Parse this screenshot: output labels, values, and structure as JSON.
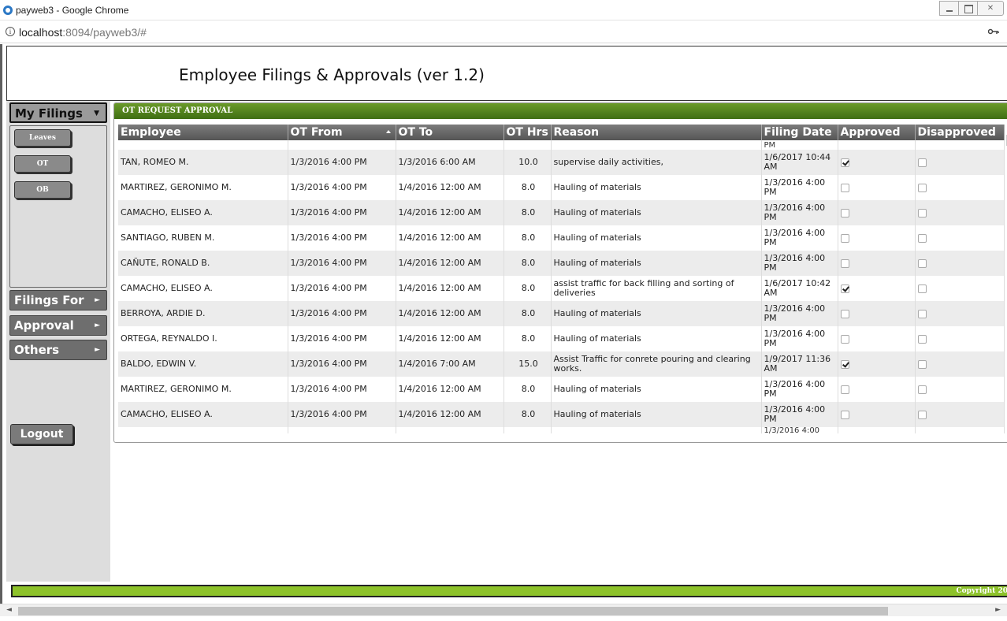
{
  "window": {
    "title": "payweb3 - Google Chrome",
    "url_host": "localhost",
    "url_rest": ":8094/payweb3/#"
  },
  "header": {
    "title": "Employee Filings & Approvals (ver 1.2)"
  },
  "sidebar": {
    "my_filings": "My Filings",
    "sub_buttons": [
      "Leaves",
      "OT",
      "OB"
    ],
    "filings_for": "Filings For",
    "approval": "Approval",
    "others": "Others",
    "logout": "Logout"
  },
  "panel": {
    "title": "OT REQUEST APPROVAL",
    "columns": [
      "Employee",
      "OT From",
      "OT To",
      "OT Hrs",
      "Reason",
      "Filing Date",
      "Approved",
      "Disapproved"
    ],
    "top_partial": {
      "filing_date": "PM"
    },
    "rows": [
      {
        "employee": "TAN, ROMEO M.",
        "ot_from": "1/3/2016 4:00 PM",
        "ot_to": "1/3/2016 6:00 AM",
        "ot_hrs": "10.0",
        "reason": "supervise daily activities,",
        "filing_date": "1/6/2017 10:44 AM",
        "approved": true,
        "disapproved": false
      },
      {
        "employee": "MARTIREZ, GERONIMO M.",
        "ot_from": "1/3/2016 4:00 PM",
        "ot_to": "1/4/2016 12:00 AM",
        "ot_hrs": "8.0",
        "reason": "Hauling of materials",
        "filing_date": "1/3/2016 4:00 PM",
        "approved": false,
        "disapproved": false
      },
      {
        "employee": "CAMACHO, ELISEO A.",
        "ot_from": "1/3/2016 4:00 PM",
        "ot_to": "1/4/2016 12:00 AM",
        "ot_hrs": "8.0",
        "reason": "Hauling of materials",
        "filing_date": "1/3/2016 4:00 PM",
        "approved": false,
        "disapproved": false
      },
      {
        "employee": "SANTIAGO, RUBEN M.",
        "ot_from": "1/3/2016 4:00 PM",
        "ot_to": "1/4/2016 12:00 AM",
        "ot_hrs": "8.0",
        "reason": "Hauling of materials",
        "filing_date": "1/3/2016 4:00 PM",
        "approved": false,
        "disapproved": false
      },
      {
        "employee": "CAÑUTE, RONALD B.",
        "ot_from": "1/3/2016 4:00 PM",
        "ot_to": "1/4/2016 12:00 AM",
        "ot_hrs": "8.0",
        "reason": "Hauling of materials",
        "filing_date": "1/3/2016 4:00 PM",
        "approved": false,
        "disapproved": false
      },
      {
        "employee": "CAMACHO, ELISEO A.",
        "ot_from": "1/3/2016 4:00 PM",
        "ot_to": "1/4/2016 12:00 AM",
        "ot_hrs": "8.0",
        "reason": "assist traffic for back filling and sorting of deliveries",
        "filing_date": "1/6/2017 10:42 AM",
        "approved": true,
        "disapproved": false
      },
      {
        "employee": "BERROYA, ARDIE D.",
        "ot_from": "1/3/2016 4:00 PM",
        "ot_to": "1/4/2016 12:00 AM",
        "ot_hrs": "8.0",
        "reason": "Hauling of materials",
        "filing_date": "1/3/2016 4:00 PM",
        "approved": false,
        "disapproved": false
      },
      {
        "employee": "ORTEGA, REYNALDO I.",
        "ot_from": "1/3/2016 4:00 PM",
        "ot_to": "1/4/2016 12:00 AM",
        "ot_hrs": "8.0",
        "reason": "Hauling of materials",
        "filing_date": "1/3/2016 4:00 PM",
        "approved": false,
        "disapproved": false
      },
      {
        "employee": "BALDO, EDWIN V.",
        "ot_from": "1/3/2016 4:00 PM",
        "ot_to": "1/4/2016 7:00 AM",
        "ot_hrs": "15.0",
        "reason": "Assist Traffic for conrete pouring and clearing works.",
        "filing_date": "1/9/2017 11:36 AM",
        "approved": true,
        "disapproved": false
      },
      {
        "employee": "MARTIREZ, GERONIMO M.",
        "ot_from": "1/3/2016 4:00 PM",
        "ot_to": "1/4/2016 12:00 AM",
        "ot_hrs": "8.0",
        "reason": "Hauling of materials",
        "filing_date": "1/3/2016 4:00 PM",
        "approved": false,
        "disapproved": false
      },
      {
        "employee": "CAMACHO, ELISEO A.",
        "ot_from": "1/3/2016 4:00 PM",
        "ot_to": "1/4/2016 12:00 AM",
        "ot_hrs": "8.0",
        "reason": "Hauling of materials",
        "filing_date": "1/3/2016 4:00 PM",
        "approved": false,
        "disapproved": false
      }
    ],
    "bottom_partial": {
      "filing_date": "1/3/2016 4:00"
    }
  },
  "footer": {
    "text": "Copyright 20"
  },
  "colors": {
    "accent_green": "#8dc22a",
    "panel_green": "#3f6e13",
    "header_gray": "#555555"
  },
  "icons": [
    "browser-icon",
    "info-icon",
    "key-icon",
    "sort-asc-icon",
    "chevron-down-icon",
    "chevron-right-icon"
  ]
}
